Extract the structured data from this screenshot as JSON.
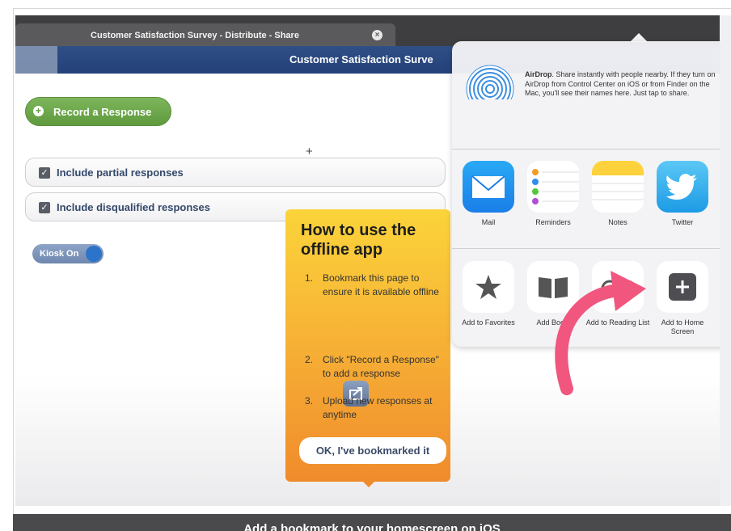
{
  "browser": {
    "tab_title": "Customer Satisfaction Survey - Distribute - Share",
    "tab_close_icon": "close-circle-icon"
  },
  "header": {
    "title": "Customer Satisfaction Surve"
  },
  "survey": {
    "record_button": "Record a Response",
    "options": [
      {
        "label": "Include partial responses",
        "checked": true
      },
      {
        "label": "Include disqualified responses",
        "checked": true
      }
    ],
    "kiosk_toggle": "Kiosk On",
    "crosshair": "+"
  },
  "popover": {
    "title": "How to use the offline app",
    "steps": [
      {
        "num": "1.",
        "text": "Bookmark this page to ensure it is available offline"
      },
      {
        "num": "2.",
        "text": "Click \"Record a Response\" to add a response"
      },
      {
        "num": "3.",
        "text": "Upload new responses at anytime"
      }
    ],
    "ok_button": "OK, I've bookmarked it",
    "colors": {
      "top": "#fbd43a",
      "bottom": "#f08b2c"
    }
  },
  "share_sheet": {
    "airdrop_title": "AirDrop",
    "airdrop_text": ". Share instantly with people nearby. If they turn on AirDrop from Control Center on iOS or from Finder on the Mac, you'll see their names here. Just tap to share.",
    "apps": [
      {
        "label": "Mail",
        "icon": "mail-icon"
      },
      {
        "label": "Reminders",
        "icon": "reminders-icon"
      },
      {
        "label": "Notes",
        "icon": "notes-icon"
      },
      {
        "label": "Twitter",
        "icon": "twitter-icon"
      }
    ],
    "actions": [
      {
        "label": "Add to Favorites",
        "icon": "star-icon"
      },
      {
        "label": "Add Booki",
        "icon": "book-icon"
      },
      {
        "label": "Add to Reading List",
        "icon": "glasses-icon"
      },
      {
        "label": "Add to Home Screen",
        "icon": "add-square-icon"
      }
    ],
    "arrow_color": "#f0567e"
  },
  "caption": "Add a bookmark to your homescreen on iOS"
}
